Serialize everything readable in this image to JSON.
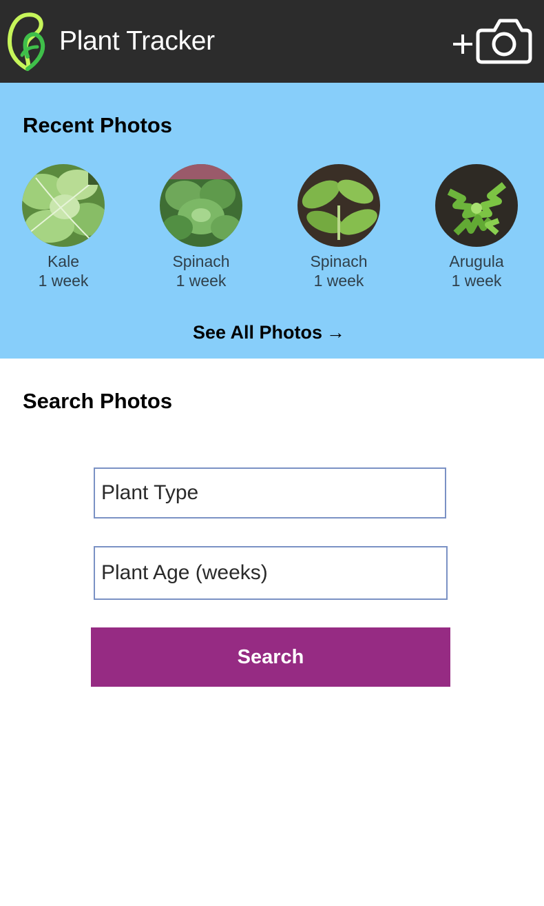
{
  "header": {
    "app_title": "Plant Tracker",
    "logo_icon": "leaf-logo-icon",
    "add_photo_icon": "add-camera-icon",
    "background": "#2c2c2c"
  },
  "recent_photos": {
    "title": "Recent Photos",
    "background": "#87cefa",
    "items": [
      {
        "name": "Kale",
        "age": "1 week",
        "image": "kale-photo"
      },
      {
        "name": "Spinach",
        "age": "1 week",
        "image": "spinach-photo"
      },
      {
        "name": "Spinach",
        "age": "1 week",
        "image": "spinach-sprout-photo"
      },
      {
        "name": "Arugula",
        "age": "1 week",
        "image": "arugula-photo"
      }
    ],
    "see_all_label": "See All Photos",
    "see_all_arrow": "→"
  },
  "search": {
    "title": "Search Photos",
    "plant_type_placeholder": "Plant Type",
    "plant_age_placeholder": "Plant Age (weeks)",
    "button_label": "Search",
    "button_color": "#962b83"
  }
}
